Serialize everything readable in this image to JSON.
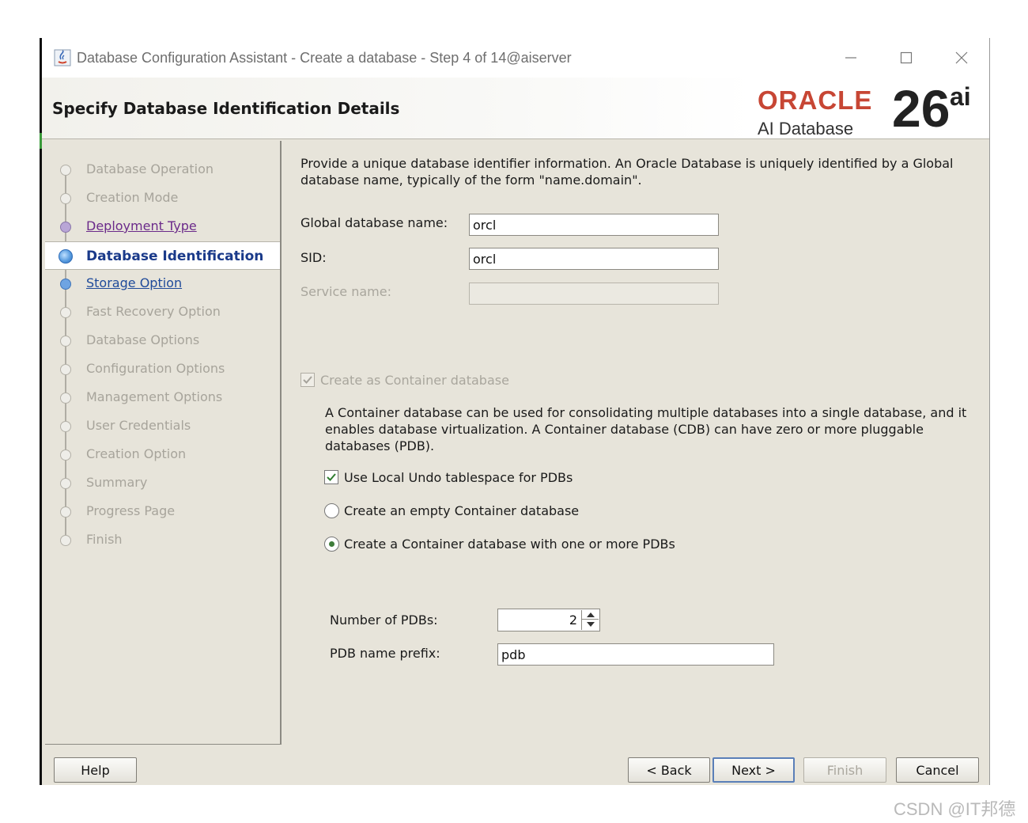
{
  "window": {
    "title": "Database Configuration Assistant - Create a database - Step 4 of 14@aiserver"
  },
  "header": {
    "title": "Specify Database Identification Details",
    "brand_word": "ORACLE",
    "brand_sub": "AI Database",
    "brand_version": "26",
    "brand_version_suffix": "ai"
  },
  "steps": [
    {
      "label": "Database Operation",
      "state": "future"
    },
    {
      "label": "Creation Mode",
      "state": "future"
    },
    {
      "label": "Deployment Type",
      "state": "visited"
    },
    {
      "label": "Database Identification",
      "state": "current"
    },
    {
      "label": "Storage Option",
      "state": "link"
    },
    {
      "label": "Fast Recovery Option",
      "state": "future"
    },
    {
      "label": "Database Options",
      "state": "future"
    },
    {
      "label": "Configuration Options",
      "state": "future"
    },
    {
      "label": "Management Options",
      "state": "future"
    },
    {
      "label": "User Credentials",
      "state": "future"
    },
    {
      "label": "Creation Option",
      "state": "future"
    },
    {
      "label": "Summary",
      "state": "future"
    },
    {
      "label": "Progress Page",
      "state": "future"
    },
    {
      "label": "Finish",
      "state": "future"
    }
  ],
  "form": {
    "description": "Provide a unique database identifier information. An Oracle Database is uniquely identified by a Global database name, typically of the form \"name.domain\".",
    "global_db_name": {
      "label": "Global database name:",
      "value": "orcl"
    },
    "sid": {
      "label": "SID:",
      "value": "orcl"
    },
    "service_name": {
      "label": "Service name:",
      "value": ""
    },
    "container_db": {
      "label": "Create as Container database",
      "checked": true
    },
    "container_desc": "A Container database can be used for consolidating multiple databases into a single database, and it enables database virtualization. A Container database (CDB) can have zero or more pluggable databases (PDB).",
    "local_undo": {
      "label": "Use Local Undo tablespace for PDBs",
      "checked": true
    },
    "radio_empty": {
      "label": "Create an empty Container database",
      "selected": false
    },
    "radio_pdbs": {
      "label": "Create a Container database with one or more PDBs",
      "selected": true
    },
    "num_pdbs": {
      "label": "Number of PDBs:",
      "value": "2"
    },
    "pdb_prefix": {
      "label": "PDB name prefix:",
      "value": "pdb"
    }
  },
  "buttons": {
    "help": "Help",
    "back": "< Back",
    "next": "Next >",
    "finish": "Finish",
    "cancel": "Cancel"
  },
  "watermark": "CSDN @IT邦德"
}
